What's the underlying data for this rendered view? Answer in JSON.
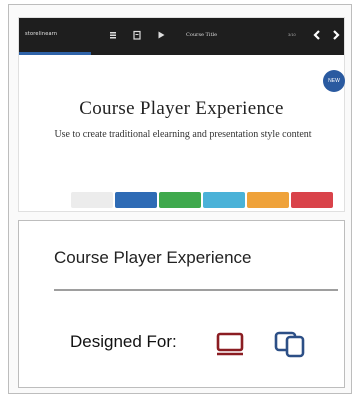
{
  "thumbnail": {
    "player_bar": {
      "logo_text": "storelinearn",
      "course_title": "Course Title",
      "slide_counter": "3/10",
      "progress_fraction": 0.22
    },
    "badge_text": "NEW",
    "title": "Course Player Experience",
    "description": "Use to create traditional elearning and presentation style content",
    "swatches": [
      "#ececec",
      "#2e6bb5",
      "#3fa94d",
      "#4ab2d8",
      "#efa23a",
      "#d9434a"
    ]
  },
  "info": {
    "title": "Course Player Experience",
    "designed_for_label": "Designed For:",
    "devices": [
      "desktop-icon",
      "tablet-phone-icon"
    ],
    "colors": {
      "desktop": "#8b1d22",
      "mobile": "#2c4f86",
      "divider": "#9e9e9e"
    }
  }
}
